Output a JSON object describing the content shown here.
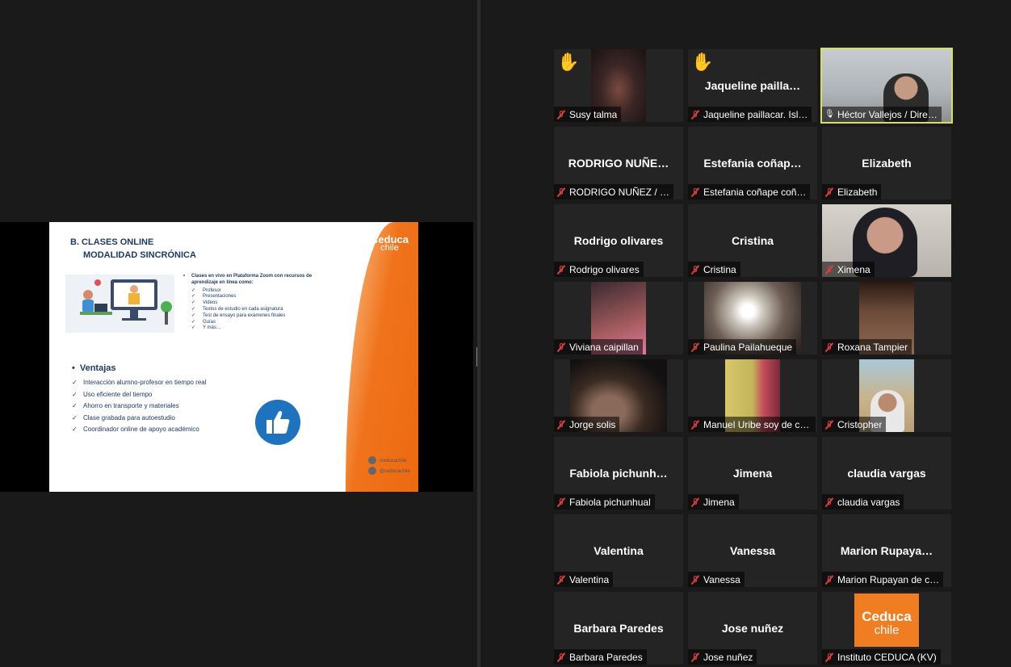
{
  "shared_screen": {
    "slide": {
      "title_line1": "B. CLASES ONLINE",
      "title_line2": "MODALIDAD SINCRÓNICA",
      "logo_line1": "Ceduca",
      "logo_line2": "chile",
      "intro": "Clases en vivo en Plataforma Zoom con recursos de aprendizaje en línea como:",
      "resources": [
        "Profesor",
        "Presentaciones",
        "Videos",
        "Textos de estudio en cada asignatura",
        "Test de ensayo para exámenes finales",
        "Guías",
        "Y más…"
      ],
      "ventajas_title": "Ventajas",
      "ventajas": [
        "Interacción alumno-profesor en tiempo real",
        "Uso eficiente del tiempo",
        "Ahorro en transporte y materiales",
        "Clase grabada para autoestudio",
        "Coordinador online de apoyo académico"
      ],
      "facebook": "/ceducachile",
      "instagram": "@ceducachile"
    }
  },
  "participants": [
    {
      "display": "",
      "label": "Susy talma",
      "hand_raised": true,
      "video": "susy",
      "muted": true
    },
    {
      "display": "Jaqueline  pailla…",
      "label": "Jaqueline paillacar. Isl…",
      "hand_raised": true,
      "video": "",
      "muted": true
    },
    {
      "display": "",
      "label": "Héctor Vallejos / Dire…",
      "hand_raised": false,
      "video": "hector",
      "muted": false,
      "active_speaker": true
    },
    {
      "display": "RODRIGO  NUÑE…",
      "label": "RODRIGO NUÑEZ / …",
      "muted": true
    },
    {
      "display": "Estefania  coñap…",
      "label": "Estefania coñape coñ…",
      "muted": true
    },
    {
      "display": "Elizabeth",
      "label": "Elizabeth",
      "muted": true
    },
    {
      "display": "Rodrigo olivares",
      "label": "Rodrigo olivares",
      "muted": true
    },
    {
      "display": "Cristina",
      "label": "Cristina",
      "muted": true
    },
    {
      "display": "",
      "label": "Ximena",
      "video": "ximena",
      "muted": true
    },
    {
      "display": "",
      "label": "Viviana caipillan",
      "video": "viviana",
      "muted": true
    },
    {
      "display": "",
      "label": "Paulina Pailahueque",
      "video": "paulina",
      "muted": true
    },
    {
      "display": "",
      "label": "Roxana Tampier",
      "video": "roxana",
      "muted": true
    },
    {
      "display": "",
      "label": "Jorge solis",
      "video": "jorge",
      "muted": true
    },
    {
      "display": "",
      "label": "Manuel Uribe  soy de ca…",
      "video": "manuel",
      "muted": false
    },
    {
      "display": "",
      "label": "Cristopher",
      "video": "cristopher",
      "muted": true
    },
    {
      "display": "Fabiola  pichunh…",
      "label": "Fabiola pichunhual",
      "muted": true
    },
    {
      "display": "Jimena",
      "label": "Jimena",
      "muted": true
    },
    {
      "display": "claudia vargas",
      "label": "claudia vargas",
      "muted": true
    },
    {
      "display": "Valentina",
      "label": "Valentina",
      "muted": true
    },
    {
      "display": "Vanessa",
      "label": "Vanessa",
      "muted": true
    },
    {
      "display": "Marion  Rupaya…",
      "label": "Marion Rupayan de c…",
      "muted": true
    },
    {
      "display": "Barbara Paredes",
      "label": "Barbara Paredes",
      "muted": true
    },
    {
      "display": "Jose nuñez",
      "label": "Jose nuñez",
      "muted": true
    },
    {
      "display": "",
      "label": "Instituto CEDUCA (KV)",
      "video": "ceduca",
      "logo_line1": "Ceduca",
      "logo_line2": "chile",
      "muted": true
    }
  ],
  "colors": {
    "background": "#1a1a1a",
    "tile": "#242424",
    "active_border": "#d6e05a",
    "muted_red": "#e03c3c",
    "ceduca_orange": "#f07d21",
    "slide_navy": "#1f3a63"
  }
}
